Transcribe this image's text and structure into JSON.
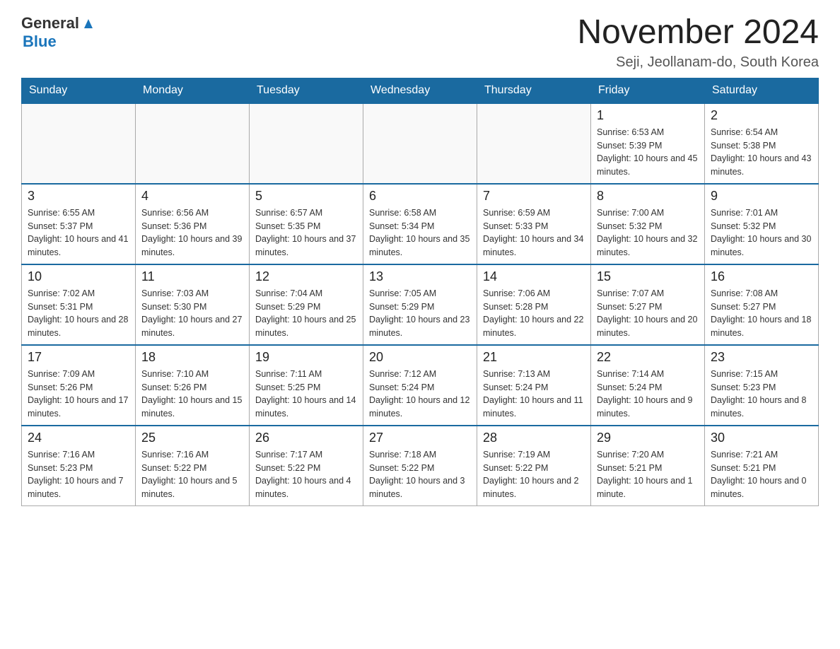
{
  "header": {
    "logo_general": "General",
    "logo_blue": "Blue",
    "month_title": "November 2024",
    "location": "Seji, Jeollanam-do, South Korea"
  },
  "days_of_week": [
    "Sunday",
    "Monday",
    "Tuesday",
    "Wednesday",
    "Thursday",
    "Friday",
    "Saturday"
  ],
  "weeks": [
    [
      {
        "day": "",
        "info": ""
      },
      {
        "day": "",
        "info": ""
      },
      {
        "day": "",
        "info": ""
      },
      {
        "day": "",
        "info": ""
      },
      {
        "day": "",
        "info": ""
      },
      {
        "day": "1",
        "info": "Sunrise: 6:53 AM\nSunset: 5:39 PM\nDaylight: 10 hours and 45 minutes."
      },
      {
        "day": "2",
        "info": "Sunrise: 6:54 AM\nSunset: 5:38 PM\nDaylight: 10 hours and 43 minutes."
      }
    ],
    [
      {
        "day": "3",
        "info": "Sunrise: 6:55 AM\nSunset: 5:37 PM\nDaylight: 10 hours and 41 minutes."
      },
      {
        "day": "4",
        "info": "Sunrise: 6:56 AM\nSunset: 5:36 PM\nDaylight: 10 hours and 39 minutes."
      },
      {
        "day": "5",
        "info": "Sunrise: 6:57 AM\nSunset: 5:35 PM\nDaylight: 10 hours and 37 minutes."
      },
      {
        "day": "6",
        "info": "Sunrise: 6:58 AM\nSunset: 5:34 PM\nDaylight: 10 hours and 35 minutes."
      },
      {
        "day": "7",
        "info": "Sunrise: 6:59 AM\nSunset: 5:33 PM\nDaylight: 10 hours and 34 minutes."
      },
      {
        "day": "8",
        "info": "Sunrise: 7:00 AM\nSunset: 5:32 PM\nDaylight: 10 hours and 32 minutes."
      },
      {
        "day": "9",
        "info": "Sunrise: 7:01 AM\nSunset: 5:32 PM\nDaylight: 10 hours and 30 minutes."
      }
    ],
    [
      {
        "day": "10",
        "info": "Sunrise: 7:02 AM\nSunset: 5:31 PM\nDaylight: 10 hours and 28 minutes."
      },
      {
        "day": "11",
        "info": "Sunrise: 7:03 AM\nSunset: 5:30 PM\nDaylight: 10 hours and 27 minutes."
      },
      {
        "day": "12",
        "info": "Sunrise: 7:04 AM\nSunset: 5:29 PM\nDaylight: 10 hours and 25 minutes."
      },
      {
        "day": "13",
        "info": "Sunrise: 7:05 AM\nSunset: 5:29 PM\nDaylight: 10 hours and 23 minutes."
      },
      {
        "day": "14",
        "info": "Sunrise: 7:06 AM\nSunset: 5:28 PM\nDaylight: 10 hours and 22 minutes."
      },
      {
        "day": "15",
        "info": "Sunrise: 7:07 AM\nSunset: 5:27 PM\nDaylight: 10 hours and 20 minutes."
      },
      {
        "day": "16",
        "info": "Sunrise: 7:08 AM\nSunset: 5:27 PM\nDaylight: 10 hours and 18 minutes."
      }
    ],
    [
      {
        "day": "17",
        "info": "Sunrise: 7:09 AM\nSunset: 5:26 PM\nDaylight: 10 hours and 17 minutes."
      },
      {
        "day": "18",
        "info": "Sunrise: 7:10 AM\nSunset: 5:26 PM\nDaylight: 10 hours and 15 minutes."
      },
      {
        "day": "19",
        "info": "Sunrise: 7:11 AM\nSunset: 5:25 PM\nDaylight: 10 hours and 14 minutes."
      },
      {
        "day": "20",
        "info": "Sunrise: 7:12 AM\nSunset: 5:24 PM\nDaylight: 10 hours and 12 minutes."
      },
      {
        "day": "21",
        "info": "Sunrise: 7:13 AM\nSunset: 5:24 PM\nDaylight: 10 hours and 11 minutes."
      },
      {
        "day": "22",
        "info": "Sunrise: 7:14 AM\nSunset: 5:24 PM\nDaylight: 10 hours and 9 minutes."
      },
      {
        "day": "23",
        "info": "Sunrise: 7:15 AM\nSunset: 5:23 PM\nDaylight: 10 hours and 8 minutes."
      }
    ],
    [
      {
        "day": "24",
        "info": "Sunrise: 7:16 AM\nSunset: 5:23 PM\nDaylight: 10 hours and 7 minutes."
      },
      {
        "day": "25",
        "info": "Sunrise: 7:16 AM\nSunset: 5:22 PM\nDaylight: 10 hours and 5 minutes."
      },
      {
        "day": "26",
        "info": "Sunrise: 7:17 AM\nSunset: 5:22 PM\nDaylight: 10 hours and 4 minutes."
      },
      {
        "day": "27",
        "info": "Sunrise: 7:18 AM\nSunset: 5:22 PM\nDaylight: 10 hours and 3 minutes."
      },
      {
        "day": "28",
        "info": "Sunrise: 7:19 AM\nSunset: 5:22 PM\nDaylight: 10 hours and 2 minutes."
      },
      {
        "day": "29",
        "info": "Sunrise: 7:20 AM\nSunset: 5:21 PM\nDaylight: 10 hours and 1 minute."
      },
      {
        "day": "30",
        "info": "Sunrise: 7:21 AM\nSunset: 5:21 PM\nDaylight: 10 hours and 0 minutes."
      }
    ]
  ]
}
